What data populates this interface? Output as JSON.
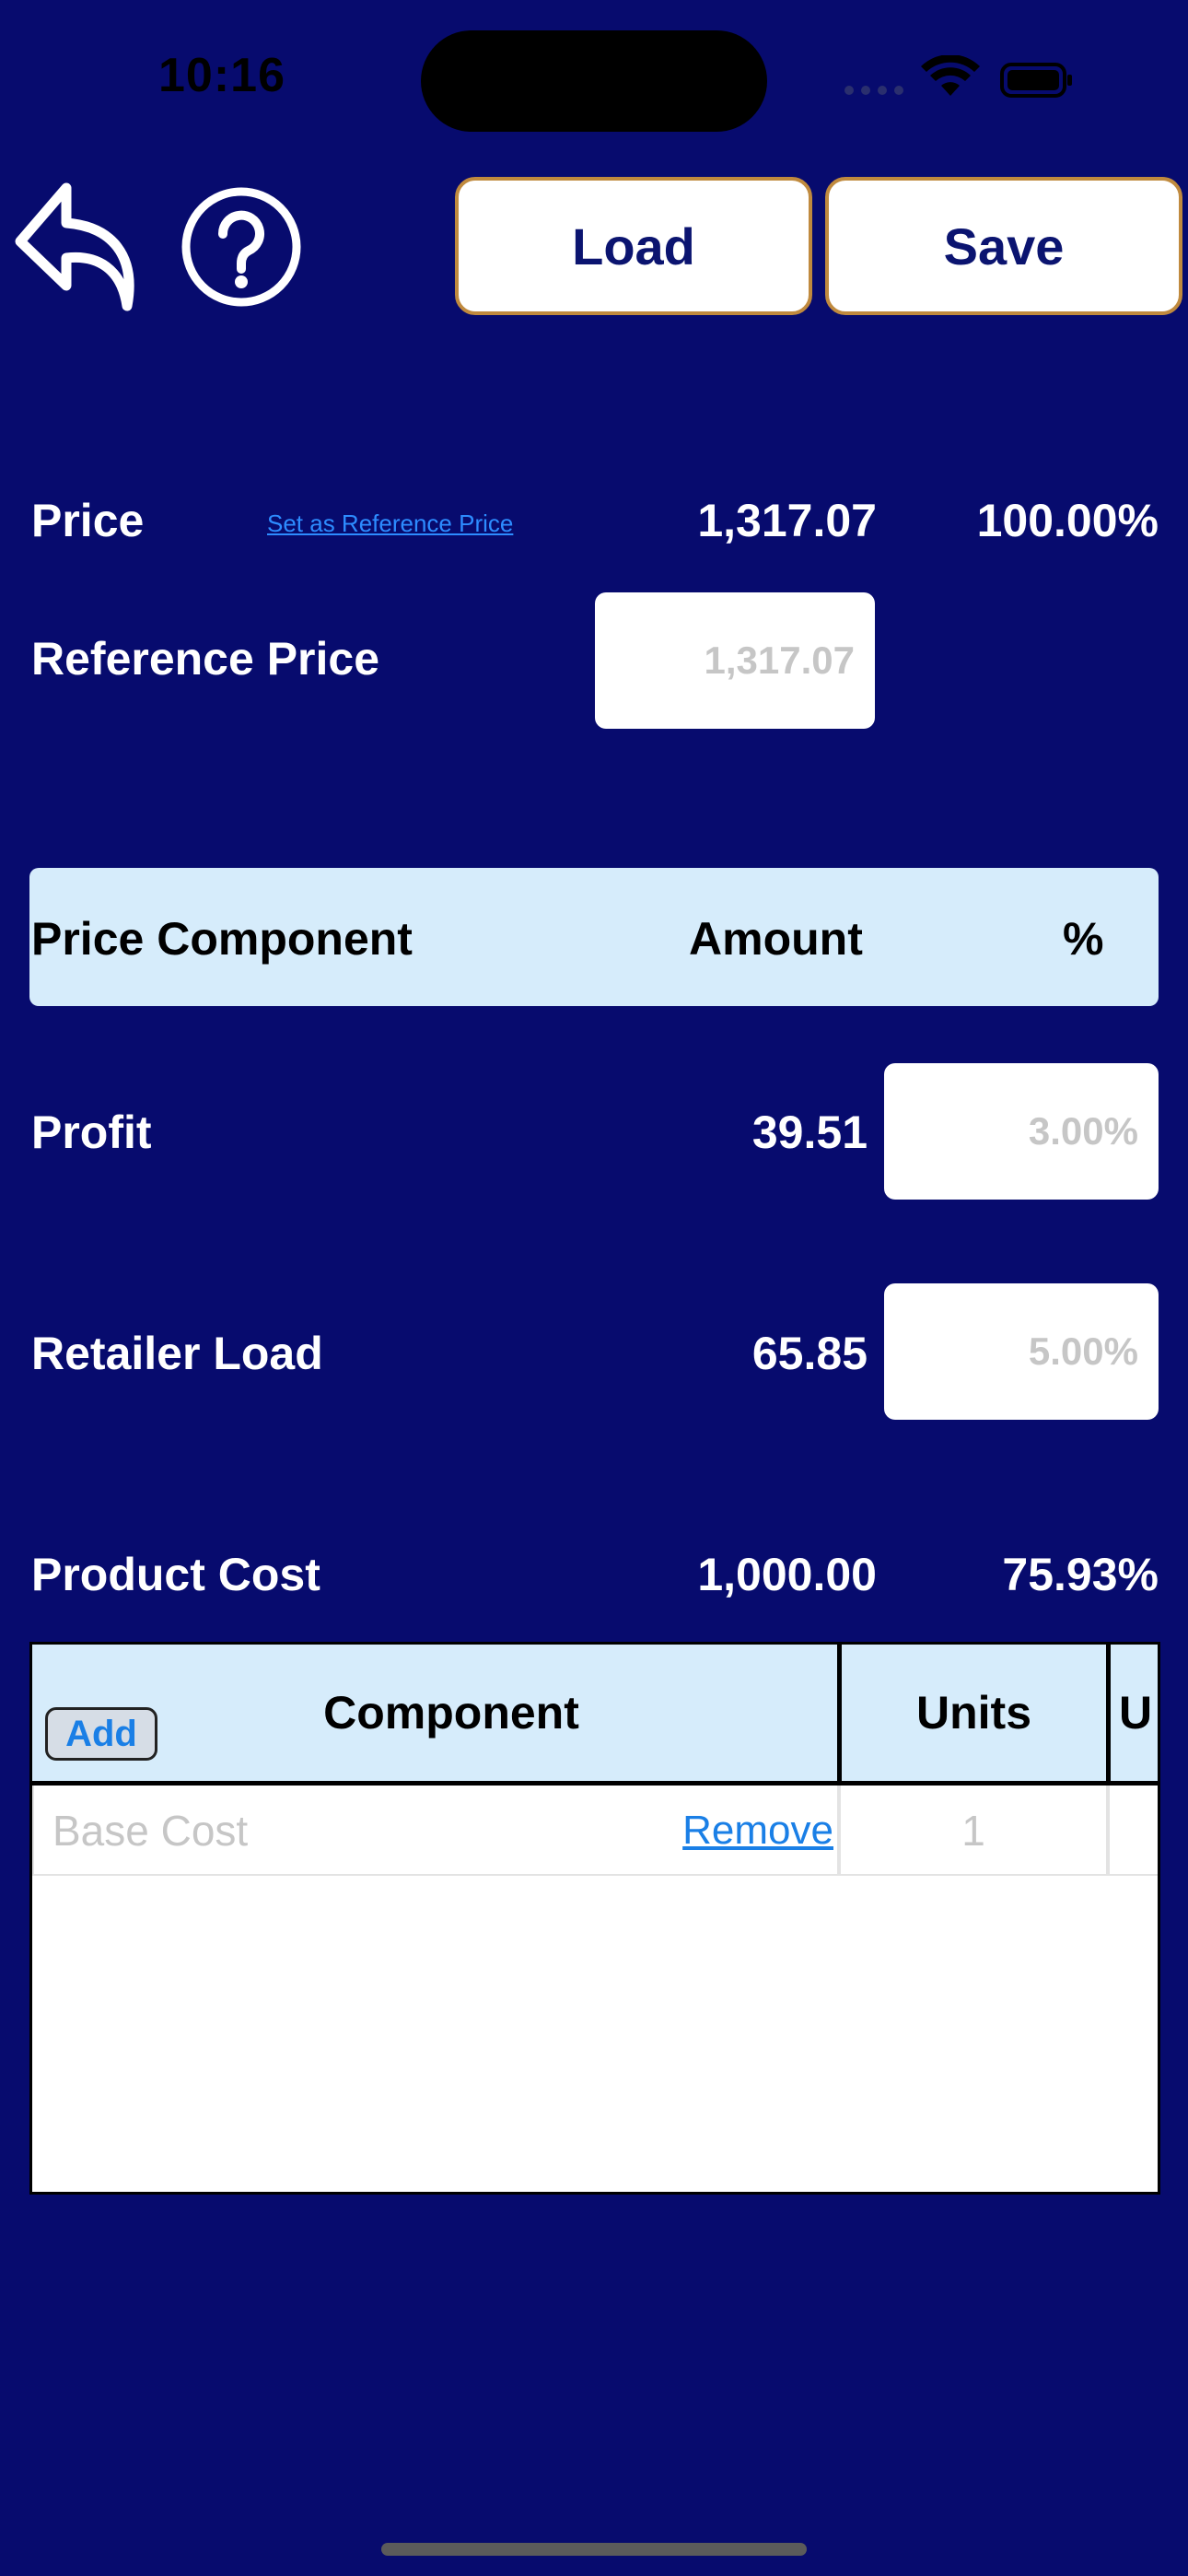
{
  "status": {
    "time": "10:16"
  },
  "toolbar": {
    "load_label": "Load",
    "save_label": "Save"
  },
  "price": {
    "label": "Price",
    "set_ref_link": "Set as Reference Price",
    "amount": "1,317.07",
    "percent": "100.00%"
  },
  "reference_price": {
    "label": "Reference Price",
    "placeholder": "1,317.07"
  },
  "components_header": {
    "col_component": "Price Component",
    "col_amount": "Amount",
    "col_percent": "%"
  },
  "profit": {
    "label": "Profit",
    "amount": "39.51",
    "percent_placeholder": "3.00%"
  },
  "retailer_load": {
    "label": "Retailer Load",
    "amount": "65.85",
    "percent_placeholder": "5.00%"
  },
  "product_cost": {
    "label": "Product Cost",
    "amount": "1,000.00",
    "percent": "75.93%"
  },
  "cost_table": {
    "add_label": "Add",
    "headers": {
      "component": "Component",
      "units": "Units",
      "unit_cost_partial": "U"
    },
    "rows": [
      {
        "component_placeholder": "Base Cost",
        "remove_label": "Remove",
        "units_placeholder": "1"
      }
    ]
  },
  "colors": {
    "background": "#070b6e",
    "header_bg": "#d6ecfb",
    "button_border": "#c08a3e",
    "link": "#2d8cff"
  }
}
